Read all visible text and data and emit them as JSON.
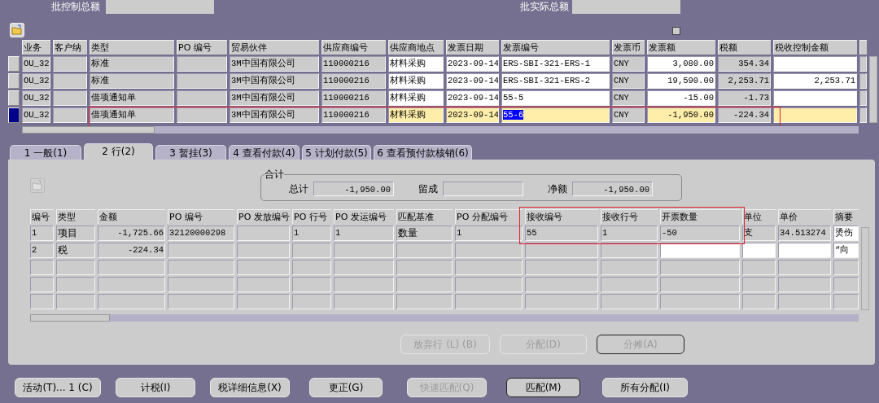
{
  "batch_totals": [
    {
      "label": "批控制总额"
    },
    {
      "label": "批实际总额"
    }
  ],
  "header_checkbox": {
    "checked": false
  },
  "invoices": {
    "columns": [
      {
        "label": "业务"
      },
      {
        "label": "客户纳"
      },
      {
        "label": "类型"
      },
      {
        "label": "PO 编号"
      },
      {
        "label": "贸易伙伴"
      },
      {
        "label": "供应商编号"
      },
      {
        "label": "供应商地点"
      },
      {
        "label": "发票日期"
      },
      {
        "label": "发票编号"
      },
      {
        "label": "发票币"
      },
      {
        "label": "发票额",
        "kind": "amount"
      },
      {
        "label": "税额",
        "kind": "amount"
      },
      {
        "label": "税收控制金额",
        "kind": "amount"
      }
    ],
    "rows": [
      {
        "selected": false,
        "framed": false,
        "cells": [
          "OU_32",
          null,
          "标准",
          null,
          "3M中国有限公司",
          "110000216",
          {
            "text": "材料采购",
            "editable": true
          },
          {
            "text": "2023-09-14",
            "editable": true
          },
          {
            "text": "ERS-SBI-321-ERS-1",
            "editable": true
          },
          "CNY",
          {
            "text": "3,080.00",
            "editable": true
          },
          "354.34",
          {
            "editable": true
          }
        ]
      },
      {
        "selected": false,
        "framed": false,
        "cells": [
          "OU_32",
          null,
          "标准",
          null,
          "3M中国有限公司",
          "110000216",
          {
            "text": "材料采购",
            "editable": true
          },
          {
            "text": "2023-09-14",
            "editable": true
          },
          {
            "text": "ERS-SBI-321-ERS-2",
            "editable": true
          },
          "CNY",
          {
            "text": "19,590.00",
            "editable": true
          },
          "2,253.71",
          {
            "text": "2,253.71",
            "editable": true
          }
        ]
      },
      {
        "selected": false,
        "framed": false,
        "cells": [
          "OU_32",
          null,
          "借项通知单",
          null,
          "3M中国有限公司",
          "110000216",
          {
            "text": "材料采购",
            "editable": true
          },
          {
            "text": "2023-09-14",
            "editable": true
          },
          {
            "text": "55-5",
            "editable": true
          },
          "CNY",
          {
            "text": "-15.00",
            "editable": true
          },
          "-1.73",
          {
            "editable": true
          }
        ]
      },
      {
        "selected": true,
        "framed": true,
        "cells": [
          "OU_32",
          null,
          "借项通知单",
          null,
          "3M中国有限公司",
          "110000216",
          {
            "text": "材料采购",
            "editable": true
          },
          {
            "text": "2023-09-14",
            "editable": true
          },
          {
            "text": "55-6",
            "editable": true,
            "highlighted": true
          },
          "CNY",
          {
            "text": "-1,950.00",
            "editable": true
          },
          "-224.34",
          {
            "editable": true
          }
        ]
      }
    ]
  },
  "tabs": [
    {
      "label": "1 一般(1)",
      "selected": false
    },
    {
      "label": "2 行(2)",
      "selected": true
    },
    {
      "label": "3 暂挂(3)",
      "selected": false
    },
    {
      "label": "4 查看付款(4)",
      "selected": false
    },
    {
      "label": "5 计划付款(5)",
      "selected": false
    },
    {
      "label": "6 查看预付款核销(6)",
      "selected": false
    }
  ],
  "totals": {
    "title": "合计",
    "fields": [
      {
        "label": "总计",
        "value": "-1,950.00"
      },
      {
        "label": "留成"
      },
      {
        "label": "净额",
        "value": "-1,950.00"
      }
    ]
  },
  "lines": {
    "columns": [
      {
        "label": "编号"
      },
      {
        "label": "类型"
      },
      {
        "label": "金额",
        "kind": "amount"
      },
      {
        "label": "PO 编号"
      },
      {
        "label": "PO 发放编号"
      },
      {
        "label": "PO 行号"
      },
      {
        "label": "PO 发运编号"
      },
      {
        "label": "匹配基准"
      },
      {
        "label": "PO 分配编号"
      },
      {
        "label": "接收编号",
        "framed": true
      },
      {
        "label": "接收行号",
        "framed": true
      },
      {
        "label": "开票数量",
        "framed": true
      },
      {
        "label": "单位"
      },
      {
        "label": "单价"
      },
      {
        "label": "摘要"
      }
    ],
    "rows": [
      {
        "framed": true,
        "cells": [
          "1",
          "项目",
          "-1,725.66",
          "32120000298",
          null,
          "1",
          "1",
          "数量",
          "1",
          "55",
          "1",
          "-50",
          "支",
          "34.513274",
          {
            "text": "烫伤",
            "editable": true
          }
        ]
      },
      {
        "framed": false,
        "cells": [
          "2",
          "税",
          "-224.34",
          null,
          null,
          null,
          null,
          null,
          null,
          null,
          null,
          {
            "editable": true
          },
          {
            "editable": true
          },
          {
            "editable": true
          },
          {
            "text": "“向",
            "editable": true
          }
        ]
      }
    ]
  },
  "line_buttons": [
    {
      "label": "放弃行 (L) (B)",
      "disabled": true,
      "default": false
    },
    {
      "label": "分配(D)",
      "disabled": true,
      "default": false
    },
    {
      "label": "分摊(A)",
      "disabled": true,
      "default": true
    }
  ],
  "buttons": [
    {
      "label": "活动(T)... 1 (C)",
      "disabled": false,
      "default": false
    },
    {
      "label": "计税(I)",
      "disabled": false,
      "default": false
    },
    {
      "label": "税详细信息(X)",
      "disabled": false,
      "default": false
    },
    {
      "label": "更正(G)",
      "disabled": false,
      "default": false
    },
    {
      "label": "快速匹配(Q)",
      "disabled": true,
      "default": false
    },
    {
      "label": "匹配(M)",
      "disabled": false,
      "default": true
    },
    {
      "label": "所有分配(I)",
      "disabled": false,
      "default": false
    }
  ]
}
